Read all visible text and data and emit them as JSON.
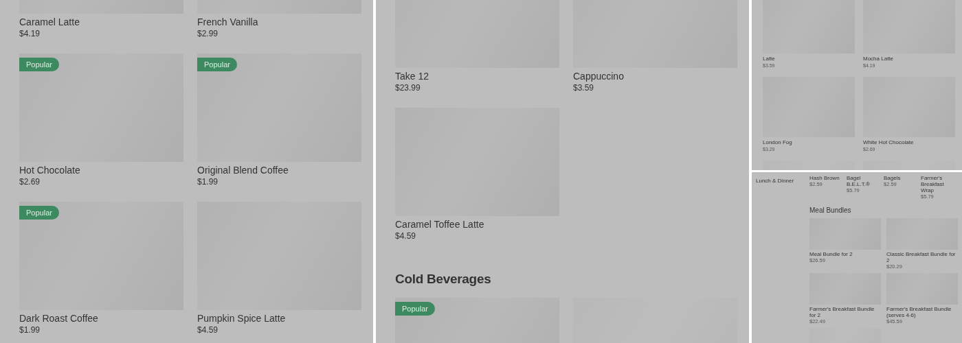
{
  "panels": [
    {
      "kind": "large",
      "sections": [
        {
          "items": [
            {
              "name": "Caramel Latte",
              "price": "$4.19"
            },
            {
              "name": "French Vanilla",
              "price": "$2.99"
            },
            {
              "name": "Hot Chocolate",
              "price": "$2.69",
              "badge": "Popular"
            },
            {
              "name": "Original Blend Coffee",
              "price": "$1.99",
              "badge": "Popular"
            },
            {
              "name": "Dark Roast Coffee",
              "price": "$1.99",
              "badge": "Popular"
            },
            {
              "name": "Pumpkin Spice Latte",
              "price": "$4.59"
            }
          ]
        }
      ]
    },
    {
      "kind": "large",
      "sections": [
        {
          "items": [
            {
              "name": "Take 12",
              "price": "$23.99"
            },
            {
              "name": "Cappuccino",
              "price": "$3.59"
            },
            {
              "name": "Caramel Toffee Latte",
              "price": "$4.59"
            }
          ]
        },
        {
          "heading": "Cold Beverages",
          "items": [
            {
              "badge": "Popular"
            },
            {
              "kind": "image"
            }
          ]
        }
      ]
    },
    {
      "kind": "small",
      "sections": [
        {
          "items": [
            {
              "name": "Latte",
              "price": "$3.59"
            },
            {
              "name": "Mocha Latte",
              "price": "$4.19"
            },
            {
              "name": "London Fog",
              "price": "$3.29"
            },
            {
              "name": "White Hot Chocolate",
              "price": "$2.69"
            },
            {
              "kind": "image"
            },
            {
              "kind": "image"
            }
          ]
        }
      ]
    },
    {
      "kind": "mini",
      "sidebar": [
        "Lunch & Dinner"
      ],
      "sections": [
        {
          "kind": "list",
          "items": [
            {
              "name": "Hash Brown",
              "price": "$2.59"
            },
            {
              "name": "Bagel B.E.L.T.®",
              "price": "$5.79"
            },
            {
              "name": "Bagels",
              "price": "$2.59"
            },
            {
              "name": "Farmer's Breakfast Wrap",
              "price": "$5.79"
            }
          ]
        },
        {
          "kind": "grid",
          "heading": "Meal Bundles",
          "items": [
            {
              "name": "Meal Bundle for 2",
              "price": "$26.59"
            },
            {
              "name": "Classic Breakfast Bundle for 2",
              "price": "$20.29"
            },
            {
              "name": "Farmer's Breakfast Bundle for 2",
              "price": "$22.49"
            },
            {
              "name": "Farmer's Breakfast Bundle (serves 4-6)",
              "price": "$45.59"
            },
            {
              "kind": "image"
            }
          ]
        }
      ]
    }
  ]
}
